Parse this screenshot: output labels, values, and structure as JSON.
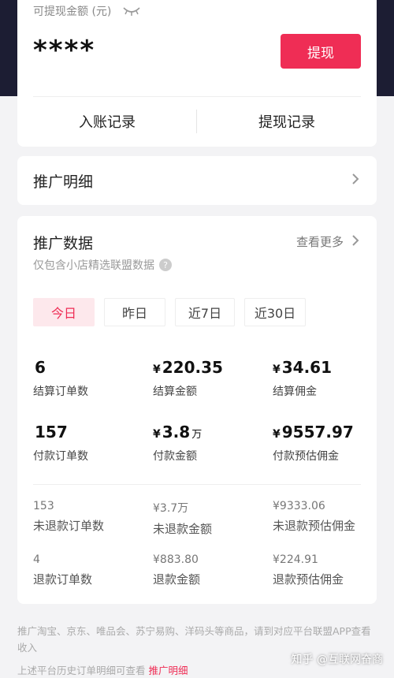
{
  "balance": {
    "label": "可提现金额 (元)",
    "value": "****",
    "withdraw_label": "提现"
  },
  "records": {
    "income_label": "入账记录",
    "withdraw_label": "提现记录"
  },
  "detail": {
    "title": "推广明细"
  },
  "data": {
    "title": "推广数据",
    "see_more": "查看更多",
    "subtitle": "仅包含小店精选联盟数据",
    "tabs": [
      "今日",
      "昨日",
      "近7日",
      "近30日"
    ],
    "active_tab": "今日",
    "metrics": [
      {
        "currency": "",
        "value": "6",
        "unit": "",
        "label": "结算订单数"
      },
      {
        "currency": "¥",
        "value": "220.35",
        "unit": "",
        "label": "结算金额"
      },
      {
        "currency": "¥",
        "value": "34.61",
        "unit": "",
        "label": "结算佣金"
      },
      {
        "currency": "",
        "value": "157",
        "unit": "",
        "label": "付款订单数"
      },
      {
        "currency": "¥",
        "value": "3.8",
        "unit": "万",
        "label": "付款金额"
      },
      {
        "currency": "¥",
        "value": "9557.97",
        "unit": "",
        "label": "付款预估佣金"
      }
    ],
    "minor_metrics": [
      {
        "value": "153",
        "label": "未退款订单数"
      },
      {
        "value": "¥3.7万",
        "label": "未退款金额"
      },
      {
        "value": "¥9333.06",
        "label": "未退款预估佣金"
      },
      {
        "value": "4",
        "label": "退款订单数"
      },
      {
        "value": "¥883.80",
        "label": "退款金额"
      },
      {
        "value": "¥224.91",
        "label": "退款预估佣金"
      }
    ]
  },
  "footer": {
    "note": "推广淘宝、京东、唯品会、苏宁易购、洋码头等商品，请到对应平台联盟APP查看收入",
    "history_prefix": "上述平台历史订单明细可查看",
    "history_link": "推广明细"
  },
  "watermark": "知乎 @互联网奋商",
  "colors": {
    "accent": "#ef2d55",
    "header_bg": "#1c1d33",
    "page_bg": "#f3f3f5"
  }
}
